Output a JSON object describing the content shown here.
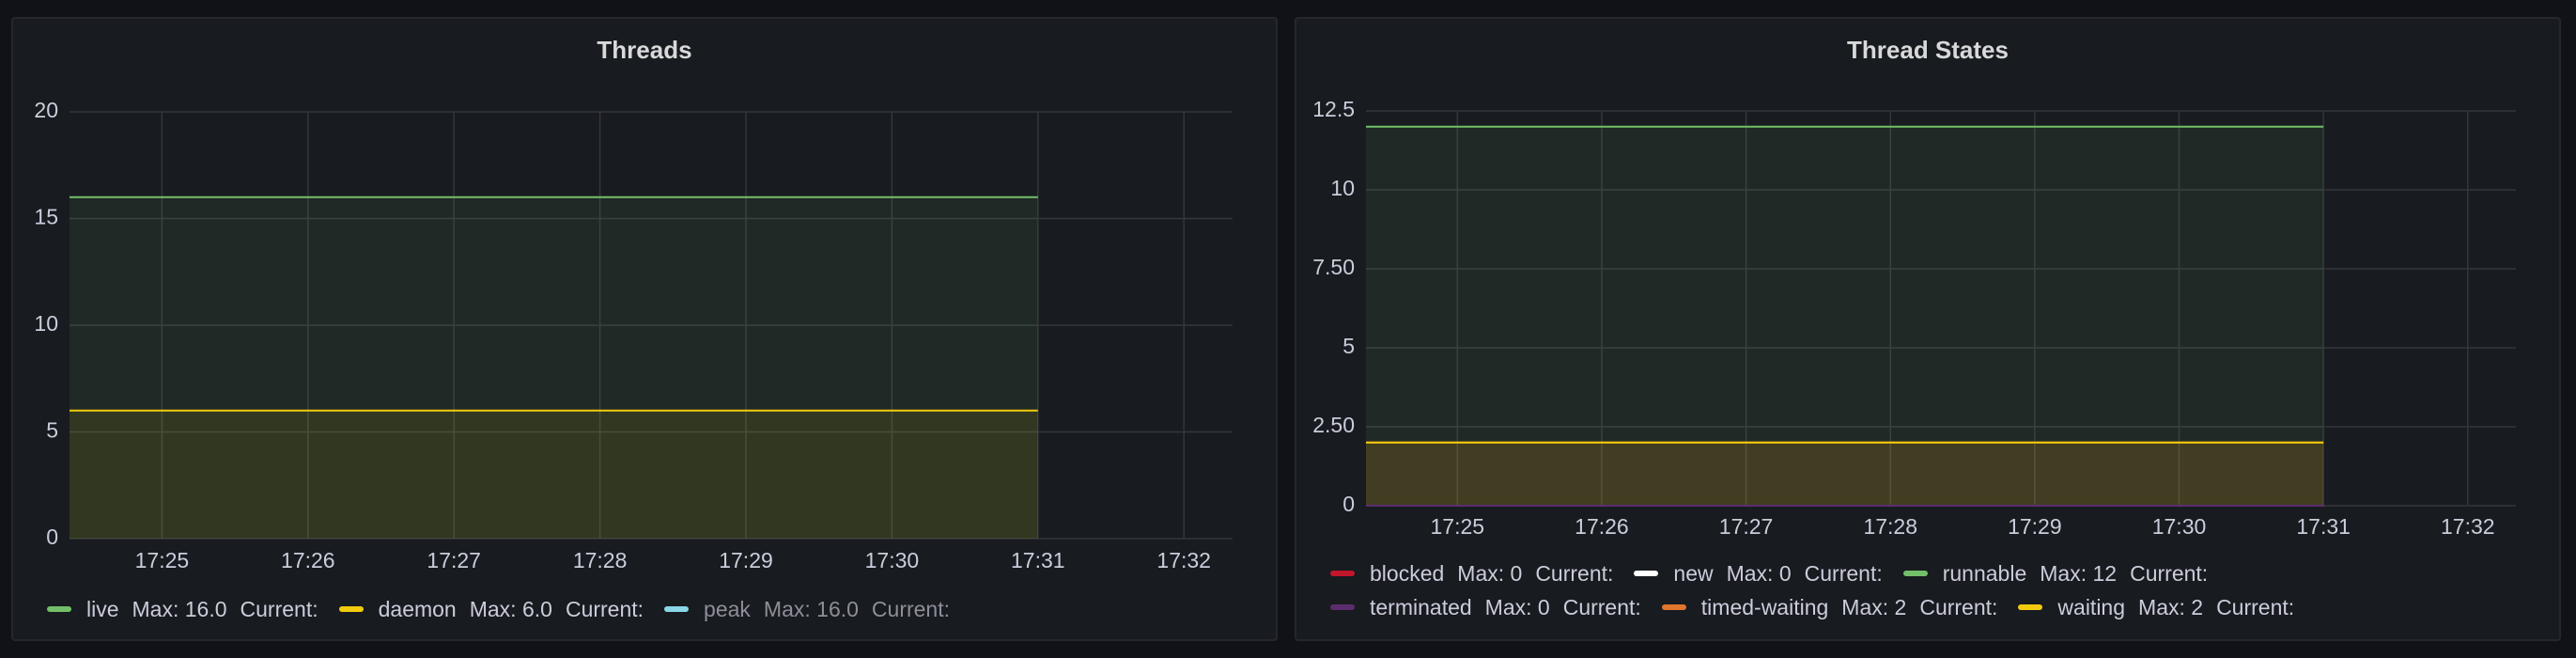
{
  "panels": [
    {
      "title": "Threads",
      "chart_data": {
        "type": "area",
        "title": "Threads",
        "x": [
          "17:25",
          "17:26",
          "17:27",
          "17:28",
          "17:29",
          "17:30",
          "17:31",
          "17:32"
        ],
        "y_ticks": [
          "0",
          "5",
          "10",
          "15",
          "20"
        ],
        "ylim": [
          0,
          20
        ],
        "x_range": [
          "17:24:22",
          "17:32:20"
        ],
        "data_end": "17:31",
        "series": [
          {
            "name": "live",
            "value": 16,
            "color": "#73bf69",
            "max": "Max: 16.0",
            "current": "Current:"
          },
          {
            "name": "daemon",
            "value": 6,
            "color": "#f2cc0c",
            "max": "Max: 6.0",
            "current": "Current:"
          },
          {
            "name": "peak",
            "value": 16,
            "color": "#8ab8ff",
            "max": "Max: 16.0",
            "current": "Current:",
            "hidden": true
          }
        ],
        "grid": true,
        "legend": "bottom"
      }
    },
    {
      "title": "Thread States",
      "chart_data": {
        "type": "area",
        "title": "Thread States",
        "x": [
          "17:25",
          "17:26",
          "17:27",
          "17:28",
          "17:29",
          "17:30",
          "17:31",
          "17:32"
        ],
        "y_ticks": [
          "0",
          "2.50",
          "5",
          "7.50",
          "10",
          "12.5"
        ],
        "ylim": [
          0,
          12.5
        ],
        "x_range": [
          "17:24:22",
          "17:32:20"
        ],
        "data_end": "17:31",
        "series": [
          {
            "name": "blocked",
            "value": 0,
            "color": "#c4162a",
            "max": "Max: 0",
            "current": "Current:"
          },
          {
            "name": "new",
            "value": 0,
            "color": "#ffffff",
            "max": "Max: 0",
            "current": "Current:"
          },
          {
            "name": "runnable",
            "value": 12,
            "color": "#73bf69",
            "max": "Max: 12",
            "current": "Current:"
          },
          {
            "name": "terminated",
            "value": 0,
            "color": "#5c2d6e",
            "max": "Max: 0",
            "current": "Current:"
          },
          {
            "name": "timed-waiting",
            "value": 2,
            "color": "#e0752d",
            "max": "Max: 2",
            "current": "Current:"
          },
          {
            "name": "waiting",
            "value": 2,
            "color": "#f2cc0c",
            "max": "Max: 2",
            "current": "Current:"
          }
        ],
        "grid": true,
        "legend": "bottom"
      }
    }
  ]
}
